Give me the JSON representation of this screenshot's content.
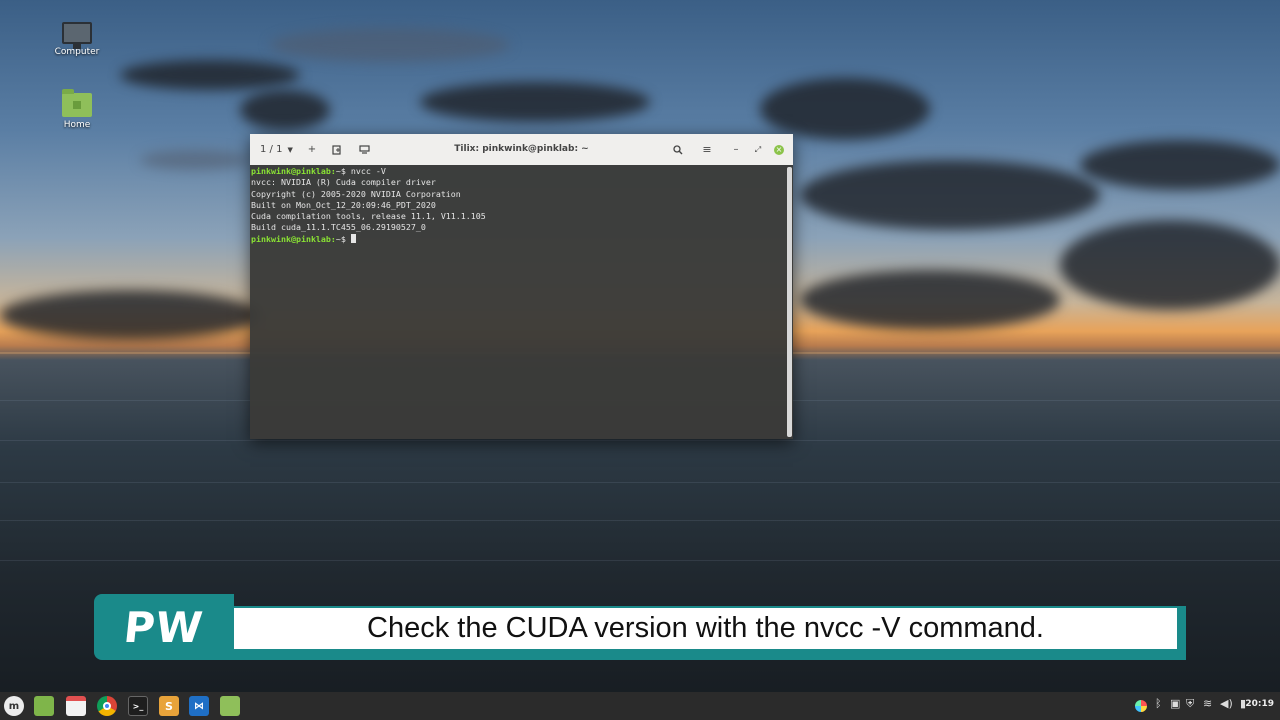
{
  "desktop": {
    "icons": [
      {
        "label": "Computer",
        "icon": "computer-icon"
      },
      {
        "label": "Home",
        "icon": "home-folder-icon"
      }
    ]
  },
  "terminal": {
    "tab_indicator": "1 / 1",
    "title": "Tilix: pinkwink@pinklab: ~",
    "lines": [
      {
        "prompt": "pinkwink@pinklab:",
        "suffix": "~$ nvcc -V"
      },
      {
        "text": "nvcc: NVIDIA (R) Cuda compiler driver"
      },
      {
        "text": "Copyright (c) 2005-2020 NVIDIA Corporation"
      },
      {
        "text": "Built on Mon_Oct_12_20:09:46_PDT_2020"
      },
      {
        "text": "Cuda compilation tools, release 11.1, V11.1.105"
      },
      {
        "text": "Build cuda_11.1.TC455_06.29190527_0"
      },
      {
        "prompt": "pinkwink@pinklab:",
        "suffix": "~$ "
      }
    ]
  },
  "banner": {
    "logo": "PW",
    "caption": "Check the CUDA version with the nvcc -V command."
  },
  "taskbar": {
    "apps": [
      "mint-menu-icon",
      "files-icon",
      "calendar-icon",
      "chrome-icon",
      "terminal-icon",
      "sublime-icon",
      "vscode-icon",
      "folder-icon"
    ],
    "tray": [
      "color-icon",
      "bluetooth-icon",
      "clipboard-icon",
      "shield-icon",
      "wifi-icon",
      "volume-icon",
      "battery-icon"
    ],
    "clock": "20:19"
  },
  "colors": {
    "prompt": "#8ae234",
    "banner": "#1a8a8a",
    "close_button": "#8bc34a"
  }
}
